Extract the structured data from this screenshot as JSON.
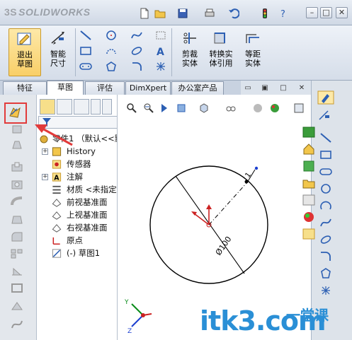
{
  "app": {
    "logo_text": "SOLIDWORKS",
    "logo_prefix": "3S"
  },
  "ribbon": {
    "exit_sketch": "退出草图",
    "smart_dimension": "智能尺寸",
    "trim": "剪裁实体",
    "convert": "转换实体引用",
    "offset": "等距实体"
  },
  "tabs": [
    "特征",
    "草图",
    "评估",
    "DimXpert",
    "办公室产品"
  ],
  "active_tab": "草图",
  "tree": {
    "root": "零件1 （默认<<默",
    "items": [
      {
        "label": "History",
        "icon": "history-icon",
        "expander": "+"
      },
      {
        "label": "传感器",
        "icon": "sensor-icon",
        "expander": ""
      },
      {
        "label": "注解",
        "icon": "annotation-icon",
        "expander": "+"
      },
      {
        "label": "材质 <未指定",
        "icon": "material-icon",
        "expander": ""
      },
      {
        "label": "前视基准面",
        "icon": "plane-icon",
        "expander": ""
      },
      {
        "label": "上视基准面",
        "icon": "plane-icon",
        "expander": ""
      },
      {
        "label": "右视基准面",
        "icon": "plane-icon",
        "expander": ""
      },
      {
        "label": "原点",
        "icon": "origin-icon",
        "expander": ""
      },
      {
        "label": "(-) 草图1",
        "icon": "sketch-icon",
        "expander": ""
      }
    ]
  },
  "sketch": {
    "dimension_text": "Ø100"
  },
  "triad": {
    "y": "Y",
    "z": "Z"
  },
  "watermark": {
    "main": "itk3.com",
    "sub": "一堂课"
  },
  "colors": {
    "accent": "#2a8fd6",
    "highlight": "#e23b3b",
    "selected": "#f9cf68"
  }
}
